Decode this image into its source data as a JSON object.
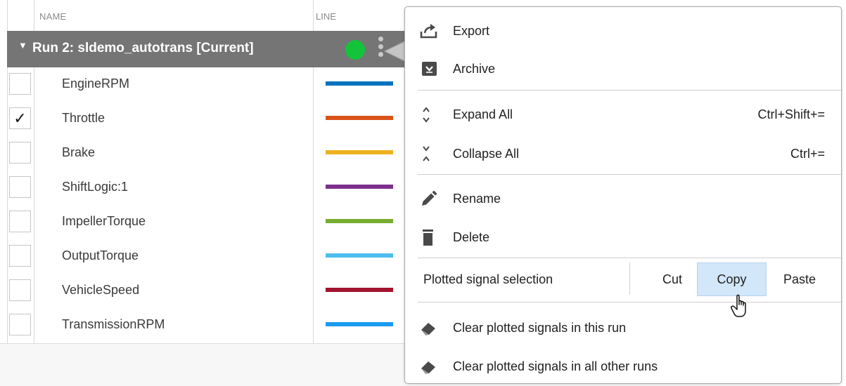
{
  "table": {
    "headers": {
      "name": "NAME",
      "line": "LINE"
    },
    "run": {
      "title": "Run 2: sldemo_autotrans [Current]",
      "status_color": "#13c43b",
      "expanded": true
    },
    "signals": [
      {
        "name": "EngineRPM",
        "checked": false,
        "color": "#0072bd"
      },
      {
        "name": "Throttle",
        "checked": true,
        "color": "#d95319"
      },
      {
        "name": "Brake",
        "checked": false,
        "color": "#edb120"
      },
      {
        "name": "ShiftLogic:1",
        "checked": false,
        "color": "#7e2f8e"
      },
      {
        "name": "ImpellerTorque",
        "checked": false,
        "color": "#77ac30"
      },
      {
        "name": "OutputTorque",
        "checked": false,
        "color": "#4dbeee"
      },
      {
        "name": "VehicleSpeed",
        "checked": false,
        "color": "#a2142f"
      },
      {
        "name": "TransmissionRPM",
        "checked": false,
        "color": "#1a9bf0"
      }
    ]
  },
  "menu": {
    "export": {
      "label": "Export",
      "icon": "export-icon"
    },
    "archive": {
      "label": "Archive",
      "icon": "archive-icon"
    },
    "expand_all": {
      "label": "Expand All",
      "shortcut": "Ctrl+Shift+=",
      "icon": "expand-all-icon"
    },
    "collapse_all": {
      "label": "Collapse All",
      "shortcut": "Ctrl+=",
      "icon": "collapse-all-icon"
    },
    "rename": {
      "label": "Rename",
      "icon": "pencil-icon"
    },
    "delete": {
      "label": "Delete",
      "icon": "trash-icon"
    },
    "plotted_selection": {
      "label": "Plotted signal selection",
      "cut": "Cut",
      "copy": "Copy",
      "paste": "Paste",
      "hovered": "Copy"
    },
    "clear_this_run": {
      "label": "Clear plotted signals in this run",
      "icon": "eraser-icon"
    },
    "clear_other_runs": {
      "label": "Clear plotted signals in all other runs",
      "icon": "eraser-icon"
    }
  },
  "colors": {
    "run_row_bg": "#757575",
    "hover_bg": "#d2e7f9"
  }
}
